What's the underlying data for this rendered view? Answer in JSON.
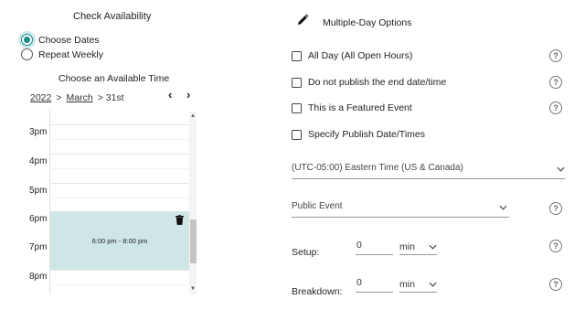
{
  "availability": {
    "title": "Check Availability",
    "options": [
      {
        "label": "Choose Dates",
        "selected": true
      },
      {
        "label": "Repeat Weekly",
        "selected": false
      }
    ],
    "subtitle": "Choose an Available Time"
  },
  "breadcrumb": {
    "year": "2022",
    "sep1": ">",
    "month": "March",
    "day": "> 31st",
    "prev": "‹",
    "next": "›"
  },
  "calendar": {
    "hours": [
      "3pm",
      "4pm",
      "5pm",
      "6pm",
      "7pm",
      "8pm"
    ],
    "event_label": "6:00 pm - 8:00 pm",
    "scroll_up": "▲",
    "scroll_down": "▼"
  },
  "options": {
    "title": "Multiple-Day Options",
    "checkboxes": [
      {
        "label": "All Day (All Open Hours)",
        "checked": false,
        "help": "?"
      },
      {
        "label": "Do not publish the end date/time",
        "checked": false,
        "help": "?"
      },
      {
        "label": "This is a Featured Event",
        "checked": false,
        "help": "?"
      },
      {
        "label": "Specify Publish Date/Times",
        "checked": false
      }
    ],
    "timezone": "(UTC-05:00) Eastern Time (US & Canada)",
    "visibility": "Public Event",
    "visibility_help": "?",
    "setup": {
      "label": "Setup:",
      "value": "0",
      "unit": "min",
      "help": "?"
    },
    "breakdown": {
      "label": "Breakdown:",
      "value": "0",
      "unit": "min",
      "help": "?"
    }
  },
  "colors": {
    "accent": "#1a8a8a",
    "event_bg": "#cfe6e6"
  }
}
